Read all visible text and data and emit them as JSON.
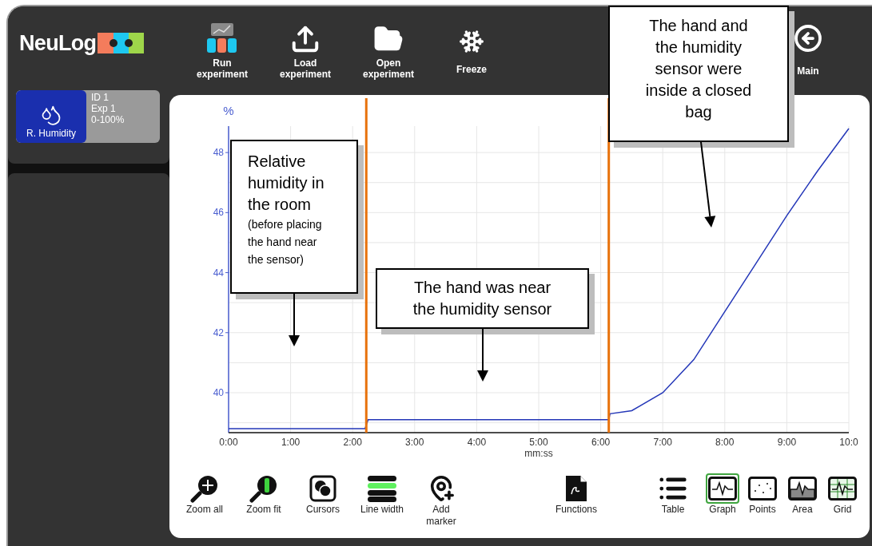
{
  "logo": {
    "text": "NeuLog"
  },
  "toolbar": [
    {
      "label": "Run experiment",
      "kind": "run"
    },
    {
      "label": "Load experiment",
      "kind": "load"
    },
    {
      "label": "Open experiment",
      "kind": "open"
    },
    {
      "label": "Freeze",
      "kind": "freeze"
    }
  ],
  "main_button": {
    "label": "Main"
  },
  "sensor": {
    "name": "R. Humidity",
    "id": "ID 1",
    "experiment": "Exp 1",
    "range": "0-100%"
  },
  "chart": {
    "chart_data": {
      "type": "line",
      "xlabel": "mm:ss",
      "ylabel": "%",
      "x": [
        0,
        0.5,
        1,
        1.5,
        2,
        2.2,
        2.25,
        2.5,
        3,
        3.5,
        4,
        4.5,
        5,
        5.5,
        6,
        6.13,
        6.15,
        6.5,
        7,
        7.5,
        8,
        8.5,
        9,
        9.5,
        10
      ],
      "series": [
        {
          "color": "#2437b8",
          "values": [
            38.8,
            38.8,
            38.8,
            38.8,
            38.8,
            38.8,
            39.1,
            39.1,
            39.1,
            39.1,
            39.1,
            39.1,
            39.1,
            39.1,
            39.1,
            39.1,
            39.3,
            39.4,
            40.0,
            41.1,
            42.7,
            44.3,
            45.9,
            47.4,
            48.8
          ]
        }
      ],
      "xlim": [
        0,
        10
      ],
      "ylim": [
        38.67,
        48.88
      ],
      "xticks": [
        {
          "value": 0,
          "label": "0:00"
        },
        {
          "value": 1,
          "label": "1:00"
        },
        {
          "value": 2,
          "label": "2:00"
        },
        {
          "value": 3,
          "label": "3:00"
        },
        {
          "value": 4,
          "label": "4:00"
        },
        {
          "value": 5,
          "label": "5:00"
        },
        {
          "value": 6,
          "label": "6:00"
        },
        {
          "value": 7,
          "label": "7:00"
        },
        {
          "value": 8,
          "label": "8:00"
        },
        {
          "value": 9,
          "label": "9:00"
        },
        {
          "value": 10,
          "label": "10:0"
        }
      ],
      "yticks": [
        40,
        42,
        44,
        46,
        48
      ],
      "grid": true,
      "ref_lines": [
        {
          "axis": "x",
          "value": 2.22,
          "color": "#e8720c"
        },
        {
          "axis": "x",
          "value": 6.13,
          "color": "#e8720c"
        }
      ]
    }
  },
  "callouts": [
    {
      "text": "Relative humidity in the room",
      "note": "(before placing the hand near the sensor)"
    },
    {
      "text": "The hand was near the humidity sensor"
    },
    {
      "text": "The hand and the humidity sensor were inside a closed bag"
    }
  ],
  "tools": [
    {
      "label": "Zoom all",
      "kind": "zoom-all"
    },
    {
      "label": "Zoom fit",
      "kind": "zoom-fit"
    },
    {
      "label": "Cursors",
      "kind": "cursors"
    },
    {
      "label": "Line width",
      "kind": "line-width"
    },
    {
      "label": "Add marker",
      "kind": "marker"
    }
  ],
  "functions_button": {
    "label": "Functions"
  },
  "view_modes": [
    {
      "label": "Table",
      "kind": "table",
      "selected": false
    },
    {
      "label": "Graph",
      "kind": "graph",
      "selected": true
    },
    {
      "label": "Points",
      "kind": "points",
      "selected": false
    },
    {
      "label": "Area",
      "kind": "area",
      "selected": false
    },
    {
      "label": "Grid",
      "kind": "grid",
      "selected": false
    }
  ]
}
